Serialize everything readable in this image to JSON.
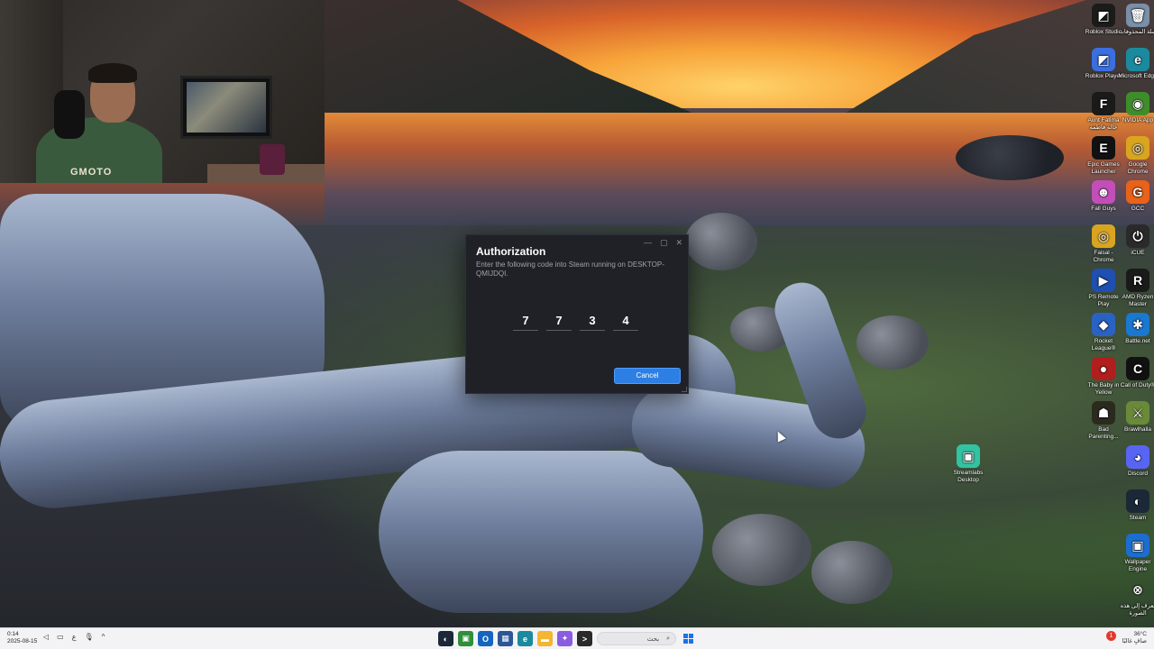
{
  "dialog": {
    "title": "Authorization",
    "description": "Enter the following code into Steam running on DESKTOP-QMIJDQI.",
    "code": [
      "7",
      "7",
      "3",
      "4"
    ],
    "cancel_label": "Cancel",
    "controls": {
      "minimize": "—",
      "maximize": "▢",
      "close": "✕"
    },
    "accent_color": "#2d7fe3"
  },
  "webcam": {
    "shirt_text": "GMOTO"
  },
  "desktop_icons": [
    {
      "label": "Roblox Studio",
      "icon": "roblox-studio-icon",
      "color": "#1b1b1b",
      "glyph": "◩"
    },
    {
      "label": "سلة المحذوفات",
      "icon": "recycle-bin-icon",
      "color": "#7a8fa8",
      "glyph": "🗑"
    },
    {
      "label": "Roblox Player",
      "icon": "roblox-player-icon",
      "color": "#3b6fe0",
      "glyph": "◩"
    },
    {
      "label": "Microsoft Edge",
      "icon": "edge-icon",
      "color": "#1b8a9e",
      "glyph": "e"
    },
    {
      "label": "Aunt Fatima خالة فاطمة",
      "icon": "aunt-fatima-icon",
      "color": "#1a1a1a",
      "glyph": "F"
    },
    {
      "label": "NVIDIA App",
      "icon": "nvidia-icon",
      "color": "#3f8d2a",
      "glyph": "◉"
    },
    {
      "label": "Epic Games Launcher",
      "icon": "epic-games-icon",
      "color": "#111111",
      "glyph": "E"
    },
    {
      "label": "Google Chrome",
      "icon": "chrome-icon",
      "color": "#d9a520",
      "glyph": "◎"
    },
    {
      "label": "Fall Guys",
      "icon": "fall-guys-icon",
      "color": "#c24fb8",
      "glyph": "☻"
    },
    {
      "label": "GCC",
      "icon": "gcc-icon",
      "color": "#e8621a",
      "glyph": "G"
    },
    {
      "label": "Faisal - Chrome",
      "icon": "chrome-profile-icon",
      "color": "#d9a520",
      "glyph": "◎"
    },
    {
      "label": "iCUE",
      "icon": "icue-icon",
      "color": "#2a2a2a",
      "glyph": "⏻"
    },
    {
      "label": "PS Remote Play",
      "icon": "ps-remote-play-icon",
      "color": "#1f4fb0",
      "glyph": "▶"
    },
    {
      "label": "AMD Ryzen Master",
      "icon": "amd-ryzen-icon",
      "color": "#1a1a1a",
      "glyph": "R"
    },
    {
      "label": "Rocket League®",
      "icon": "rocket-league-icon",
      "color": "#2a62c4",
      "glyph": "◆"
    },
    {
      "label": "Battle.net",
      "icon": "battlenet-icon",
      "color": "#1a78d0",
      "glyph": "✱"
    },
    {
      "label": "The Baby in Yellow",
      "icon": "baby-in-yellow-icon",
      "color": "#b01e1e",
      "glyph": "●"
    },
    {
      "label": "Call of Duty®",
      "icon": "call-of-duty-icon",
      "color": "#111111",
      "glyph": "C"
    },
    {
      "label": "Bad Parenting...",
      "icon": "bad-parenting-icon",
      "color": "#2a2a1e",
      "glyph": "☗"
    },
    {
      "label": "Brawlhalla",
      "icon": "brawlhalla-icon",
      "color": "#6a8a3a",
      "glyph": "⚔"
    },
    {
      "label": "Discord",
      "icon": "discord-icon",
      "color": "#5865f2",
      "glyph": "◕"
    },
    {
      "label": "Steam",
      "icon": "steam-icon",
      "color": "#1b2838",
      "glyph": "◐"
    },
    {
      "label": "Wallpaper Engine",
      "icon": "wallpaper-engine-icon",
      "color": "#1b6ed0",
      "glyph": "▣"
    },
    {
      "label": "تعرف إلى هذه الصورة",
      "icon": "learn-about-picture-icon",
      "color": "transparent",
      "glyph": "⊗"
    }
  ],
  "streamlabs": {
    "label": "Streamlabs Desktop",
    "icon": "streamlabs-icon",
    "color": "#31c3a2",
    "glyph": "▣"
  },
  "taskbar": {
    "time": "0:14",
    "date": "2025-08-15",
    "tray_left": [
      "◁",
      "▭",
      "ع",
      "🎙",
      "^"
    ],
    "search_label": "بحث",
    "weather_temp": "36°C",
    "weather_desc": "صافٍ غالبًا",
    "notification_count": "1",
    "apps": [
      {
        "name": "steam-taskbar-icon",
        "color": "#1b2838",
        "glyph": "◐"
      },
      {
        "name": "xbox-taskbar-icon",
        "color": "#2f8f3a",
        "glyph": "▣"
      },
      {
        "name": "outlook-taskbar-icon",
        "color": "#1565c0",
        "glyph": "O"
      },
      {
        "name": "store-taskbar-icon",
        "color": "#2b5797",
        "glyph": "▦"
      },
      {
        "name": "edge-taskbar-icon",
        "color": "#1b8a9e",
        "glyph": "e"
      },
      {
        "name": "file-explorer-taskbar-icon",
        "color": "#f2b632",
        "glyph": "▬"
      },
      {
        "name": "copilot-taskbar-icon",
        "color": "#8a5ce0",
        "glyph": "✦"
      },
      {
        "name": "terminal-taskbar-icon",
        "color": "#2a2a2a",
        "glyph": ">"
      }
    ]
  }
}
